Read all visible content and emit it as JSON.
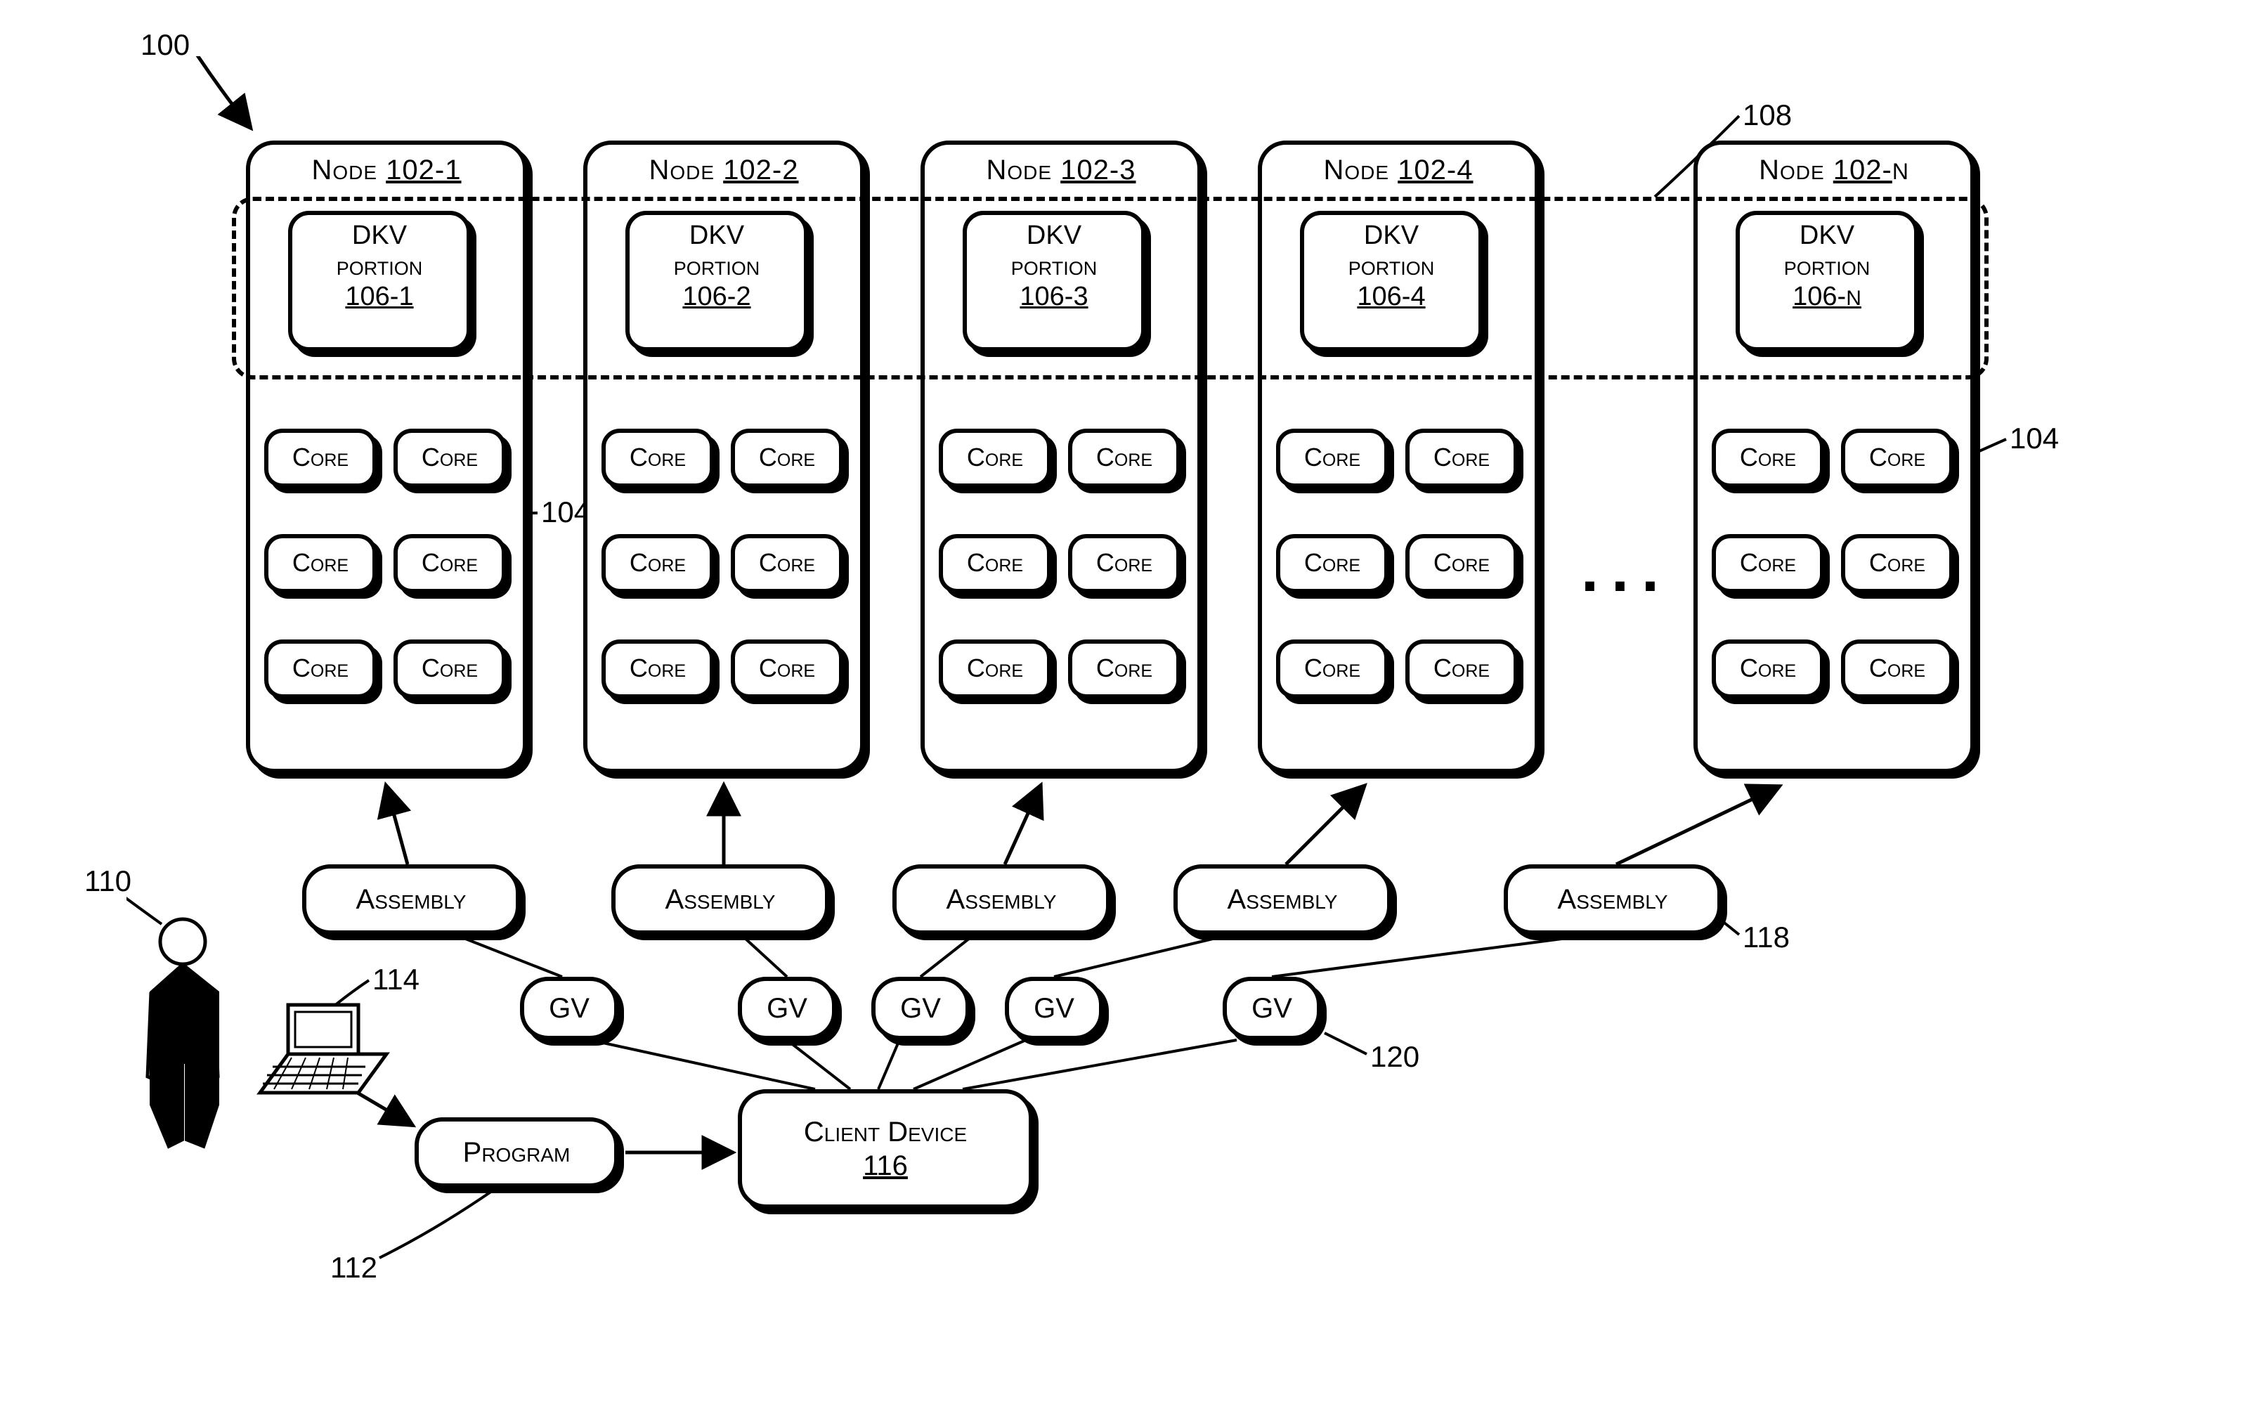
{
  "refs": {
    "r100": "100",
    "r108": "108",
    "r104a": "104",
    "r104b": "104",
    "r110": "110",
    "r114": "114",
    "r112": "112",
    "r118": "118",
    "r120": "120"
  },
  "nodes": [
    {
      "label_prefix": "Node ",
      "label_num": "102-1"
    },
    {
      "label_prefix": "Node ",
      "label_num": "102-2"
    },
    {
      "label_prefix": "Node ",
      "label_num": "102-3"
    },
    {
      "label_prefix": "Node ",
      "label_num": "102-4"
    },
    {
      "label_prefix": "Node ",
      "label_num": "102-",
      "label_suffix": "N"
    }
  ],
  "dkv": {
    "line1": "DKV",
    "line2": "portion",
    "nums": [
      "106-1",
      "106-2",
      "106-3",
      "106-4",
      "106-",
      "N"
    ]
  },
  "core_label": "Core",
  "ellipsis": "...",
  "assembly_label": "Assembly",
  "gv_label": "GV",
  "program_label": "Program",
  "client_device": {
    "line1": "Client Device",
    "num": "116"
  }
}
